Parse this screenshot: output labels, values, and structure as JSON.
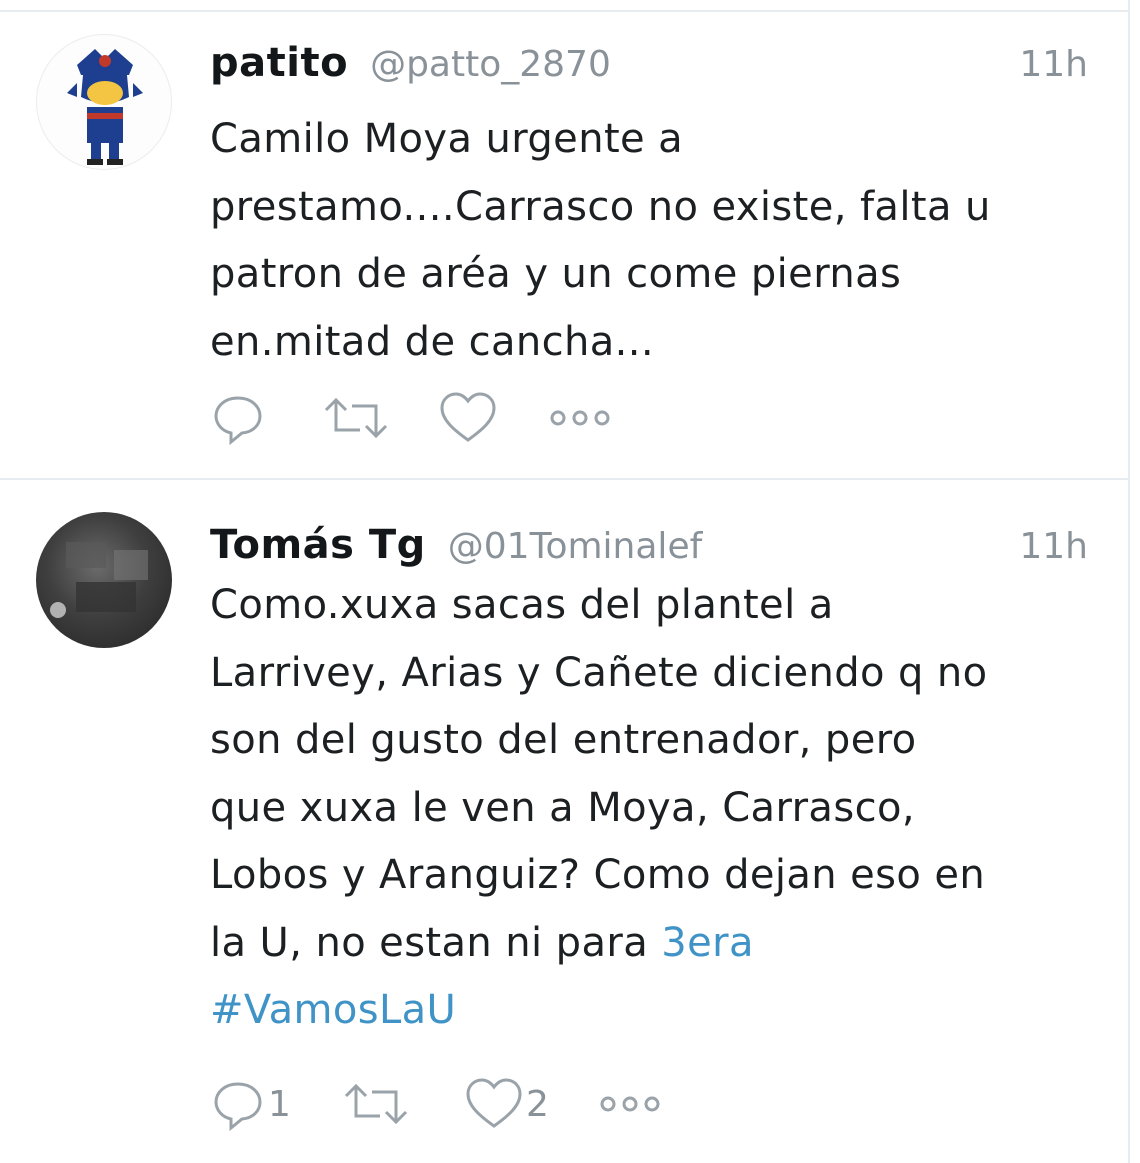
{
  "tweets": [
    {
      "name": "patito",
      "handle": "@patto_2870",
      "time": "11h",
      "lines": [
        "Camilo Moya urgente a",
        "prestamo....Carrasco no existe, falta u",
        "patron de aréa y un come piernas",
        "en.mitad de cancha..."
      ],
      "actions": {
        "reply_icon": "reply-icon",
        "retweet_icon": "retweet-icon",
        "like_icon": "heart-icon",
        "more_icon": "more-icon"
      }
    },
    {
      "name": "Tomás Tg",
      "handle": "@01Tominalef",
      "time": "11h",
      "lines": [
        "Como.xuxa sacas del plantel a",
        "Larrivey, Arias y Cañete diciendo q no",
        "son del gusto del entrenador, pero",
        "que xuxa le ven a Moya, Carrasco,",
        "Lobos y Aranguiz? Como dejan eso en",
        "la U, no estan ni para"
      ],
      "link_inline": "3era",
      "hashtag": "#VamosLaU",
      "reply_count": "1",
      "like_count": "2",
      "actions": {
        "reply_icon": "reply-icon",
        "retweet_icon": "retweet-icon",
        "like_icon": "heart-icon",
        "more_icon": "more-icon"
      }
    }
  ],
  "colors": {
    "text": "#1c2022",
    "muted": "#8a9299",
    "link": "#3f93c6",
    "divider": "#e6ecf0"
  }
}
